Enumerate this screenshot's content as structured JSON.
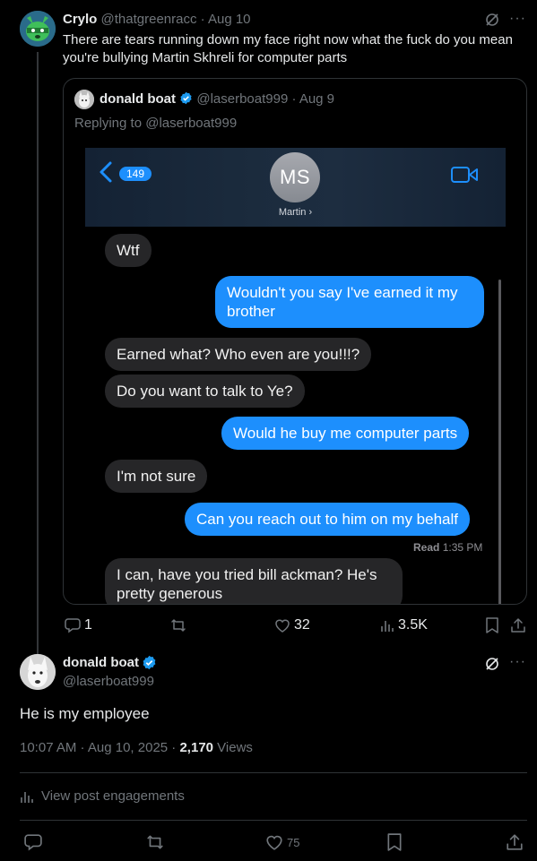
{
  "reply_tweet": {
    "author_name": "Crylo",
    "author_handle": "@thatgreenracc",
    "date": "Aug 10",
    "text": "There are tears running down my face right now what the fuck do you mean you're bullying Martin Skhreli for computer parts",
    "more_label": "···"
  },
  "quoted_tweet": {
    "author_name": "donald boat",
    "author_handle": "@laserboat999",
    "date": "Aug 9",
    "replying_to": "Replying to @laserboat999",
    "imessage": {
      "back_count": "149",
      "contact_initials": "MS",
      "contact_name": "Martin ›",
      "messages": [
        {
          "side": "in",
          "text": "Wtf"
        },
        {
          "side": "out",
          "text": "Wouldn't you say I've earned it my brother"
        },
        {
          "side": "in",
          "text": "Earned what? Who even are you!!!?"
        },
        {
          "side": "in",
          "text": "Do you want to talk to Ye?"
        },
        {
          "side": "out",
          "text": "Would he buy me computer parts"
        },
        {
          "side": "in",
          "text": "I'm not sure"
        },
        {
          "side": "out",
          "text": "Can you reach out to him on my behalf"
        },
        {
          "side": "in",
          "text": "I can, have you tried bill ackman? He's pretty generous"
        }
      ],
      "read_receipt": {
        "label": "Read",
        "time": "1:35 PM"
      }
    }
  },
  "reply_actions": {
    "replies": "1",
    "retweets": "",
    "likes": "32",
    "views": "3.5K"
  },
  "main_tweet": {
    "author_name": "donald boat",
    "author_handle": "@laserboat999",
    "text": "He is my employee",
    "timestamp": "10:07 AM · Aug 10, 2025 · ",
    "views_count": "2,170",
    "views_label": " Views",
    "engagements_label": "View post engagements",
    "more_label": "···"
  },
  "main_actions": {
    "likes": "75"
  },
  "colors": {
    "background": "#000000",
    "text_primary": "#e7e9ea",
    "text_muted": "#71767b",
    "verified": "#1d9bf0",
    "imessage_blue": "#1d8ffd",
    "imessage_gray": "#262628"
  }
}
